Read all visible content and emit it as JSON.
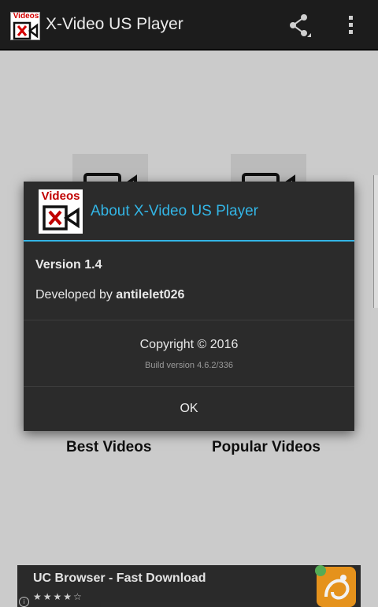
{
  "app_bar": {
    "logo_text": "Videos",
    "title": "X-Video US Player",
    "icons": [
      "share-icon",
      "more-vert-icon"
    ]
  },
  "background": {
    "tiles": [
      "video-camera-icon",
      "video-camera-icon"
    ],
    "labels": [
      "Best Videos",
      "Popular Videos"
    ]
  },
  "dialog": {
    "logo_text": "Videos",
    "logo_icon": "video-x-icon",
    "title": "About X-Video US Player",
    "version": "Version 1.4",
    "developed_prefix": "Developed by",
    "developer": "antilelet026",
    "copyright": "Copyright © 2016",
    "build": "Build version 4.6.2/336",
    "ok_label": "OK",
    "accent_color": "#33b5e5"
  },
  "ad": {
    "title": "UC Browser - Fast Download",
    "stars": "★★★★☆",
    "info_icon": "i",
    "app_icon": "uc-browser-icon"
  }
}
